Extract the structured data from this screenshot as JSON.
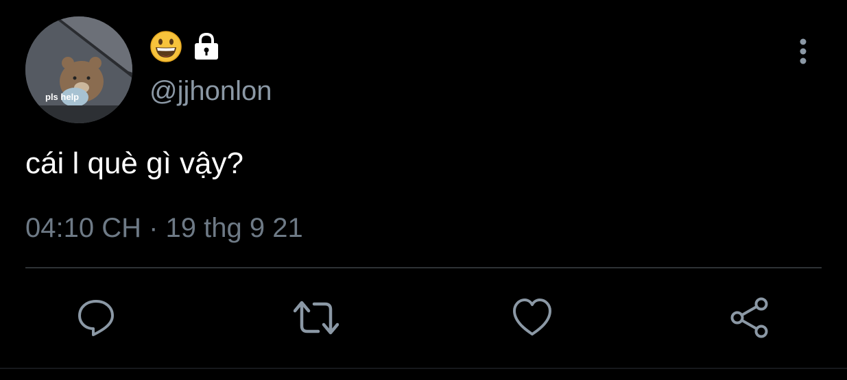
{
  "profile": {
    "avatar_caption": "pls help",
    "display_name_icons": [
      "grinning-face-emoji",
      "lock-icon"
    ],
    "handle": "@jjhonlon"
  },
  "tweet": {
    "text": "cái l què gì vậy?",
    "timestamp": "04:10 CH · 19 thg 9 21"
  },
  "actions": [
    "reply-icon",
    "retweet-icon",
    "like-icon",
    "share-icon"
  ],
  "colors": {
    "background": "#000000",
    "text_primary": "#ffffff",
    "text_secondary": "#8b98a5",
    "icon": "#8b98a5",
    "divider": "#2f3336"
  }
}
